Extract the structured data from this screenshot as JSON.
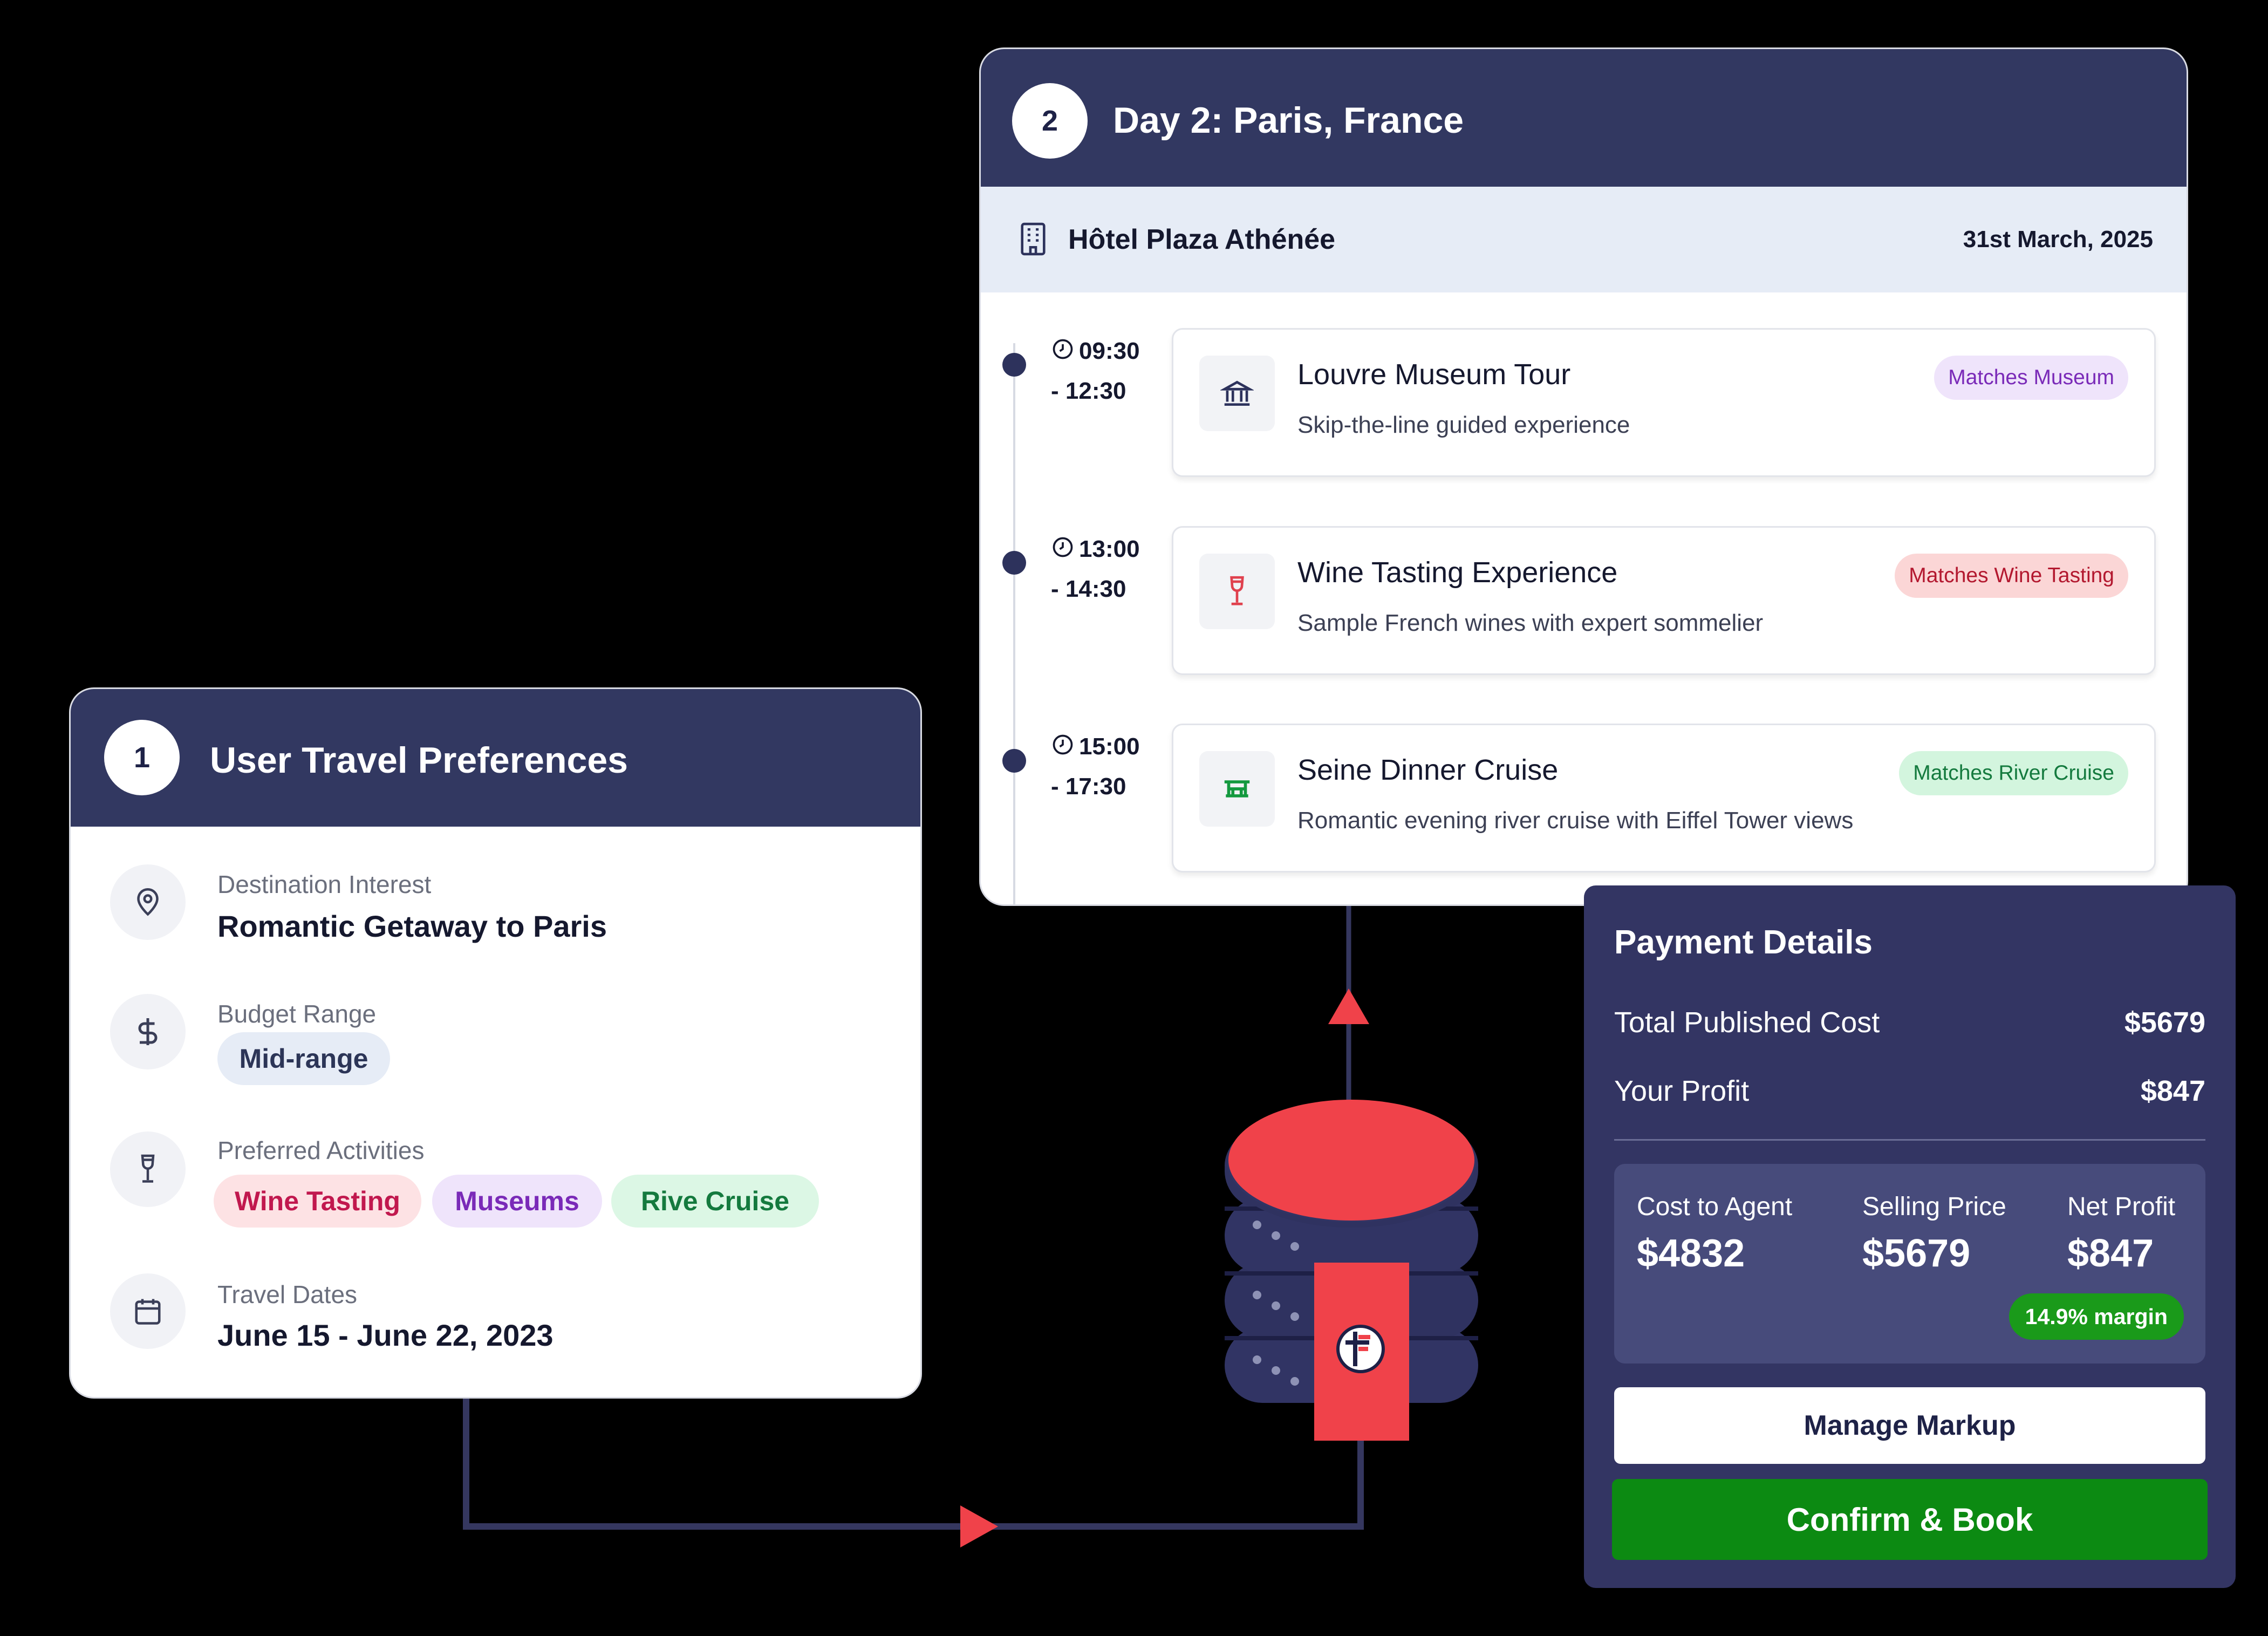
{
  "preferences": {
    "step": "1",
    "title": "User Travel Preferences",
    "destination": {
      "label": "Destination Interest",
      "value": "Romantic Getaway to Paris",
      "icon": "map-pin-icon"
    },
    "budget": {
      "label": "Budget Range",
      "value": "Mid-range",
      "icon": "dollar-icon"
    },
    "activities": {
      "label": "Preferred Activities",
      "icon": "wine-glass-icon",
      "chips": [
        "Wine Tasting",
        "Museums",
        "Rive Cruise"
      ]
    },
    "dates": {
      "label": "Travel Dates",
      "value": "June 15 - June 22, 2023",
      "icon": "calendar-icon"
    }
  },
  "itinerary": {
    "step": "2",
    "title": "Day 2: Paris, France",
    "hotel": "Hôtel Plaza Athénée",
    "date": "31st March, 2025",
    "activities": [
      {
        "time_start": "09:30",
        "time_end": "- 12:30",
        "title": "Louvre Museum Tour",
        "description": "Skip-the-line guided experience",
        "tag": "Matches Museum",
        "icon": "museum-icon"
      },
      {
        "time_start": "13:00",
        "time_end": "- 14:30",
        "title": "Wine Tasting Experience",
        "description": "Sample French wines with expert sommelier",
        "tag": "Matches Wine Tasting",
        "icon": "wine-glass-icon"
      },
      {
        "time_start": "15:00",
        "time_end": "- 17:30",
        "title": "Seine Dinner Cruise",
        "description": "Romantic evening river cruise with Eiffel Tower views",
        "tag": "Matches River Cruise",
        "icon": "boat-icon"
      }
    ]
  },
  "payment": {
    "title": "Payment Details",
    "total_label": "Total Published Cost",
    "total_value": "$5679",
    "profit_label": "Your Profit",
    "profit_value": "$847",
    "stats": [
      {
        "label": "Cost to Agent",
        "value": "$4832"
      },
      {
        "label": "Selling Price",
        "value": "$5679"
      },
      {
        "label": "Net Profit",
        "value": "$847"
      }
    ],
    "margin": "14.9% margin",
    "manage_button": "Manage Markup",
    "confirm_button": "Confirm & Book"
  },
  "colors": {
    "header_navy": "#323861",
    "arrow_red": "#f0424a",
    "database_navy": "#313464",
    "wine_chip": "#fde2e4",
    "museum_chip": "#efe4fb",
    "cruise_chip": "#dcf7e5",
    "confirm_green": "#0c8a12"
  }
}
